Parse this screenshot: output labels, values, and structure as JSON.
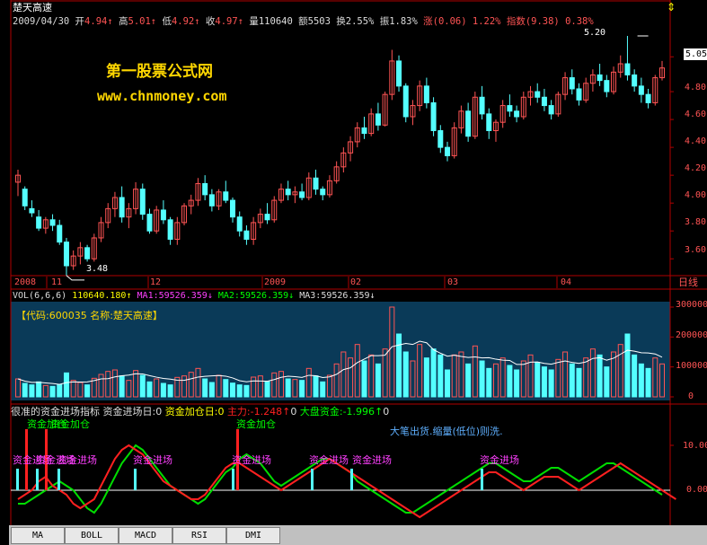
{
  "header": {
    "stock_name": "楚天高速",
    "date": "2009/04/30",
    "open_label": "开",
    "open": "4.94",
    "high_label": "高",
    "high": "5.01",
    "low_label": "低",
    "low": "4.92",
    "close_label": "收",
    "close": "4.97",
    "vol_label": "量",
    "vol": "110640",
    "amount_label": "额",
    "amount": "5503",
    "turnover_label": "换",
    "turnover": "2.55%",
    "amplitude_label": "振",
    "amplitude": "1.83%",
    "change_label": "涨",
    "change": "(0.06)",
    "change_pct": "1.22%",
    "index_label": "指数",
    "index_change": "(9.38)",
    "index_pct": "0.38%"
  },
  "watermark": {
    "line1": "第一股票公式网",
    "line2": "www.chnmoney.com"
  },
  "price_axis": {
    "ticks": [
      "5.05",
      "4.80",
      "4.60",
      "4.40",
      "4.20",
      "4.00",
      "3.80",
      "3.60"
    ],
    "current": "5.05",
    "period": "日线"
  },
  "annotations": {
    "high": "5.20",
    "low": "3.48"
  },
  "time_axis": [
    "2008",
    "11",
    "12",
    "2009",
    "02",
    "03",
    "04"
  ],
  "volume": {
    "label": "VOL(6,6,6)",
    "vol": "110640.180",
    "ma1_label": "MA1:",
    "ma1": "59526.359",
    "ma2_label": "MA2:",
    "ma2": "59526.359",
    "ma3_label": "MA3:",
    "ma3": "59526.359",
    "code_text": "【代码:600035 名称:楚天高速】",
    "ticks": [
      "300000",
      "200000",
      "100000",
      "0"
    ]
  },
  "indicator": {
    "title": "很准的资金进场指标",
    "jc_day_label": "资金进场日:",
    "jc_day": "0",
    "jc_add_label": "资金加仓日:",
    "jc_add": "0",
    "main_label": "主力:",
    "main": "-1.248",
    "big_label": "大盘资金:",
    "big": "-1.996",
    "note": "大笔出货.缩量(低位)则洗.",
    "ticks": [
      "10.00",
      "0.00"
    ],
    "signal_enter": "资金进场",
    "signal_add": "资金加仓"
  },
  "tabs": [
    "MA",
    "BOLL",
    "MACD",
    "RSI",
    "DMI"
  ],
  "colors": {
    "up": "#ff5454",
    "down": "#54ffff",
    "axis": "#b00000",
    "green": "#00dd00",
    "red": "#ff2020",
    "yellow": "#ffff00",
    "magenta": "#ff40ff"
  },
  "chart_data": {
    "type": "candlestick",
    "price_range": [
      3.4,
      5.25
    ],
    "candles": [
      {
        "o": 4.15,
        "h": 4.24,
        "l": 4.05,
        "c": 4.2
      },
      {
        "o": 4.1,
        "h": 4.12,
        "l": 3.95,
        "c": 3.98
      },
      {
        "o": 3.96,
        "h": 4.02,
        "l": 3.9,
        "c": 3.93
      },
      {
        "o": 3.9,
        "h": 3.95,
        "l": 3.8,
        "c": 3.82
      },
      {
        "o": 3.82,
        "h": 3.9,
        "l": 3.78,
        "c": 3.88
      },
      {
        "o": 3.88,
        "h": 3.92,
        "l": 3.8,
        "c": 3.84
      },
      {
        "o": 3.84,
        "h": 3.88,
        "l": 3.7,
        "c": 3.72
      },
      {
        "o": 3.72,
        "h": 3.75,
        "l": 3.48,
        "c": 3.55
      },
      {
        "o": 3.55,
        "h": 3.66,
        "l": 3.52,
        "c": 3.62
      },
      {
        "o": 3.62,
        "h": 3.72,
        "l": 3.56,
        "c": 3.68
      },
      {
        "o": 3.68,
        "h": 3.7,
        "l": 3.58,
        "c": 3.6
      },
      {
        "o": 3.6,
        "h": 3.78,
        "l": 3.58,
        "c": 3.75
      },
      {
        "o": 3.75,
        "h": 3.9,
        "l": 3.72,
        "c": 3.86
      },
      {
        "o": 3.86,
        "h": 4.0,
        "l": 3.82,
        "c": 3.96
      },
      {
        "o": 3.96,
        "h": 4.08,
        "l": 3.9,
        "c": 4.04
      },
      {
        "o": 4.04,
        "h": 4.12,
        "l": 3.86,
        "c": 3.9
      },
      {
        "o": 3.9,
        "h": 4.0,
        "l": 3.82,
        "c": 3.96
      },
      {
        "o": 3.96,
        "h": 4.15,
        "l": 3.92,
        "c": 4.1
      },
      {
        "o": 4.1,
        "h": 4.14,
        "l": 3.88,
        "c": 3.92
      },
      {
        "o": 3.92,
        "h": 3.96,
        "l": 3.78,
        "c": 3.8
      },
      {
        "o": 3.8,
        "h": 3.98,
        "l": 3.78,
        "c": 3.95
      },
      {
        "o": 3.95,
        "h": 4.02,
        "l": 3.85,
        "c": 3.88
      },
      {
        "o": 3.88,
        "h": 3.9,
        "l": 3.7,
        "c": 3.74
      },
      {
        "o": 3.74,
        "h": 3.9,
        "l": 3.7,
        "c": 3.86
      },
      {
        "o": 3.86,
        "h": 4.0,
        "l": 3.84,
        "c": 3.98
      },
      {
        "o": 3.98,
        "h": 4.06,
        "l": 3.92,
        "c": 4.02
      },
      {
        "o": 4.02,
        "h": 4.18,
        "l": 3.98,
        "c": 4.14
      },
      {
        "o": 4.14,
        "h": 4.2,
        "l": 4.02,
        "c": 4.06
      },
      {
        "o": 4.06,
        "h": 4.1,
        "l": 3.94,
        "c": 3.98
      },
      {
        "o": 3.98,
        "h": 4.1,
        "l": 3.95,
        "c": 4.08
      },
      {
        "o": 4.08,
        "h": 4.16,
        "l": 4.0,
        "c": 4.02
      },
      {
        "o": 4.02,
        "h": 4.04,
        "l": 3.86,
        "c": 3.9
      },
      {
        "o": 3.9,
        "h": 3.94,
        "l": 3.76,
        "c": 3.8
      },
      {
        "o": 3.8,
        "h": 3.84,
        "l": 3.7,
        "c": 3.74
      },
      {
        "o": 3.74,
        "h": 3.9,
        "l": 3.7,
        "c": 3.86
      },
      {
        "o": 3.86,
        "h": 3.96,
        "l": 3.82,
        "c": 3.92
      },
      {
        "o": 3.92,
        "h": 4.0,
        "l": 3.85,
        "c": 3.88
      },
      {
        "o": 3.88,
        "h": 4.05,
        "l": 3.86,
        "c": 4.02
      },
      {
        "o": 4.02,
        "h": 4.14,
        "l": 4.0,
        "c": 4.1
      },
      {
        "o": 4.1,
        "h": 4.16,
        "l": 4.02,
        "c": 4.06
      },
      {
        "o": 4.06,
        "h": 4.12,
        "l": 4.0,
        "c": 4.08
      },
      {
        "o": 4.08,
        "h": 4.14,
        "l": 4.02,
        "c": 4.04
      },
      {
        "o": 4.04,
        "h": 4.22,
        "l": 4.02,
        "c": 4.18
      },
      {
        "o": 4.18,
        "h": 4.24,
        "l": 4.06,
        "c": 4.1
      },
      {
        "o": 4.1,
        "h": 4.12,
        "l": 4.02,
        "c": 4.06
      },
      {
        "o": 4.06,
        "h": 4.2,
        "l": 4.04,
        "c": 4.16
      },
      {
        "o": 4.16,
        "h": 4.3,
        "l": 4.14,
        "c": 4.26
      },
      {
        "o": 4.26,
        "h": 4.4,
        "l": 4.22,
        "c": 4.36
      },
      {
        "o": 4.36,
        "h": 4.48,
        "l": 4.3,
        "c": 4.44
      },
      {
        "o": 4.44,
        "h": 4.58,
        "l": 4.4,
        "c": 4.54
      },
      {
        "o": 4.54,
        "h": 4.62,
        "l": 4.46,
        "c": 4.5
      },
      {
        "o": 4.5,
        "h": 4.68,
        "l": 4.48,
        "c": 4.64
      },
      {
        "o": 4.64,
        "h": 4.72,
        "l": 4.52,
        "c": 4.56
      },
      {
        "o": 4.56,
        "h": 4.8,
        "l": 4.55,
        "c": 4.78
      },
      {
        "o": 4.78,
        "h": 5.1,
        "l": 4.74,
        "c": 5.02
      },
      {
        "o": 5.02,
        "h": 5.06,
        "l": 4.8,
        "c": 4.84
      },
      {
        "o": 4.84,
        "h": 4.86,
        "l": 4.58,
        "c": 4.62
      },
      {
        "o": 4.62,
        "h": 4.74,
        "l": 4.56,
        "c": 4.7
      },
      {
        "o": 4.7,
        "h": 4.88,
        "l": 4.66,
        "c": 4.84
      },
      {
        "o": 4.84,
        "h": 4.9,
        "l": 4.68,
        "c": 4.72
      },
      {
        "o": 4.72,
        "h": 4.76,
        "l": 4.48,
        "c": 4.52
      },
      {
        "o": 4.52,
        "h": 4.56,
        "l": 4.36,
        "c": 4.4
      },
      {
        "o": 4.4,
        "h": 4.44,
        "l": 4.3,
        "c": 4.34
      },
      {
        "o": 4.34,
        "h": 4.58,
        "l": 4.32,
        "c": 4.54
      },
      {
        "o": 4.54,
        "h": 4.7,
        "l": 4.5,
        "c": 4.66
      },
      {
        "o": 4.66,
        "h": 4.72,
        "l": 4.44,
        "c": 4.48
      },
      {
        "o": 4.48,
        "h": 4.8,
        "l": 4.46,
        "c": 4.76
      },
      {
        "o": 4.76,
        "h": 4.84,
        "l": 4.6,
        "c": 4.64
      },
      {
        "o": 4.64,
        "h": 4.68,
        "l": 4.46,
        "c": 4.52
      },
      {
        "o": 4.52,
        "h": 4.6,
        "l": 4.44,
        "c": 4.58
      },
      {
        "o": 4.58,
        "h": 4.74,
        "l": 4.54,
        "c": 4.7
      },
      {
        "o": 4.7,
        "h": 4.78,
        "l": 4.62,
        "c": 4.66
      },
      {
        "o": 4.66,
        "h": 4.7,
        "l": 4.58,
        "c": 4.62
      },
      {
        "o": 4.62,
        "h": 4.8,
        "l": 4.6,
        "c": 4.76
      },
      {
        "o": 4.76,
        "h": 4.84,
        "l": 4.7,
        "c": 4.8
      },
      {
        "o": 4.8,
        "h": 4.86,
        "l": 4.72,
        "c": 4.76
      },
      {
        "o": 4.76,
        "h": 4.82,
        "l": 4.66,
        "c": 4.7
      },
      {
        "o": 4.7,
        "h": 4.74,
        "l": 4.6,
        "c": 4.64
      },
      {
        "o": 4.64,
        "h": 4.8,
        "l": 4.62,
        "c": 4.78
      },
      {
        "o": 4.78,
        "h": 4.94,
        "l": 4.74,
        "c": 4.9
      },
      {
        "o": 4.9,
        "h": 4.96,
        "l": 4.78,
        "c": 4.82
      },
      {
        "o": 4.82,
        "h": 4.86,
        "l": 4.7,
        "c": 4.74
      },
      {
        "o": 4.74,
        "h": 4.9,
        "l": 4.72,
        "c": 4.86
      },
      {
        "o": 4.86,
        "h": 4.96,
        "l": 4.8,
        "c": 4.92
      },
      {
        "o": 4.92,
        "h": 5.0,
        "l": 4.84,
        "c": 4.88
      },
      {
        "o": 4.88,
        "h": 4.92,
        "l": 4.76,
        "c": 4.8
      },
      {
        "o": 4.8,
        "h": 4.98,
        "l": 4.78,
        "c": 4.94
      },
      {
        "o": 4.94,
        "h": 5.06,
        "l": 4.9,
        "c": 5.0
      },
      {
        "o": 5.0,
        "h": 5.2,
        "l": 4.88,
        "c": 4.92
      },
      {
        "o": 4.92,
        "h": 4.96,
        "l": 4.8,
        "c": 4.84
      },
      {
        "o": 4.84,
        "h": 4.9,
        "l": 4.72,
        "c": 4.78
      },
      {
        "o": 4.78,
        "h": 4.82,
        "l": 4.68,
        "c": 4.72
      },
      {
        "o": 4.72,
        "h": 4.92,
        "l": 4.7,
        "c": 4.9
      },
      {
        "o": 4.9,
        "h": 5.02,
        "l": 4.88,
        "c": 4.97
      }
    ],
    "volume": [
      60,
      45,
      40,
      50,
      38,
      35,
      42,
      80,
      55,
      48,
      40,
      62,
      75,
      85,
      90,
      70,
      55,
      88,
      72,
      50,
      60,
      45,
      40,
      65,
      70,
      82,
      95,
      60,
      48,
      72,
      58,
      46,
      40,
      38,
      66,
      70,
      52,
      80,
      85,
      60,
      58,
      55,
      95,
      70,
      50,
      72,
      110,
      150,
      130,
      175,
      120,
      140,
      110,
      160,
      300,
      210,
      150,
      120,
      175,
      130,
      160,
      140,
      90,
      140,
      150,
      110,
      170,
      120,
      95,
      110,
      130,
      105,
      90,
      120,
      140,
      115,
      100,
      90,
      125,
      150,
      110,
      95,
      130,
      160,
      140,
      100,
      150,
      175,
      210,
      140,
      110,
      95,
      130,
      110
    ],
    "main_line": [
      -2,
      -1,
      0,
      2,
      3,
      1,
      0,
      -1,
      -3,
      -4,
      -3,
      -2,
      1,
      4,
      7,
      9,
      10,
      9,
      8,
      6,
      4,
      2,
      1,
      0,
      -1,
      -2,
      -2,
      -1,
      1,
      3,
      5,
      6,
      6,
      5,
      4,
      3,
      2,
      1,
      0,
      1,
      2,
      3,
      4,
      5,
      6,
      7,
      6,
      5,
      4,
      3,
      2,
      1,
      0,
      -1,
      -2,
      -3,
      -4,
      -5,
      -6,
      -5,
      -4,
      -3,
      -2,
      -1,
      0,
      1,
      2,
      3,
      4,
      4,
      3,
      2,
      1,
      0,
      1,
      2,
      3,
      3,
      3,
      2,
      1,
      0,
      1,
      2,
      3,
      4,
      5,
      6,
      5,
      4,
      3,
      2,
      1,
      0,
      -1,
      -2
    ],
    "fund_line": [
      -3,
      -3,
      -2,
      -1,
      0,
      1,
      2,
      1,
      0,
      -2,
      -4,
      -5,
      -3,
      0,
      3,
      6,
      8,
      10,
      9,
      7,
      5,
      3,
      1,
      0,
      -1,
      -2,
      -3,
      -2,
      0,
      2,
      4,
      5,
      7,
      8,
      7,
      6,
      4,
      2,
      1,
      2,
      3,
      4,
      5,
      6,
      7,
      7,
      6,
      5,
      4,
      2,
      1,
      0,
      -1,
      -2,
      -3,
      -4,
      -5,
      -5,
      -4,
      -3,
      -2,
      -1,
      0,
      1,
      2,
      3,
      4,
      5,
      6,
      6,
      5,
      4,
      3,
      2,
      2,
      3,
      4,
      5,
      5,
      4,
      3,
      2,
      3,
      4,
      5,
      6,
      6,
      5,
      4,
      3,
      2,
      1,
      0,
      -1
    ]
  }
}
